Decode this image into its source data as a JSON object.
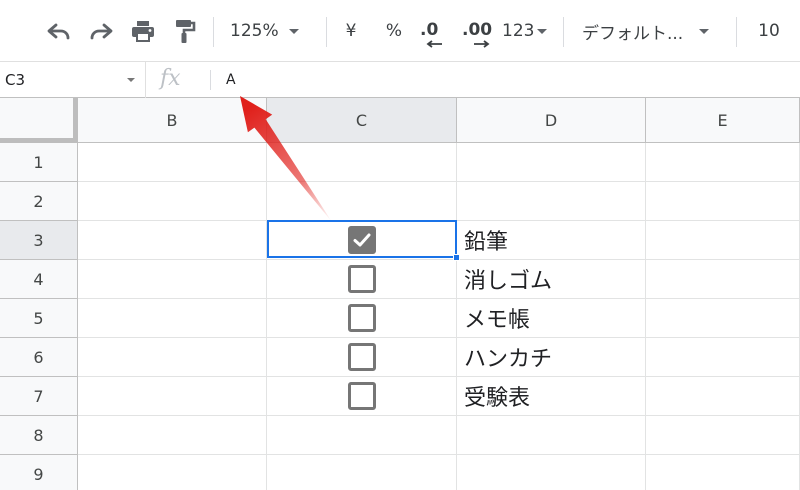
{
  "toolbar": {
    "zoom": "125%",
    "currency_symbol": "¥",
    "percent_symbol": "%",
    "decrease_decimal_label": ".0",
    "increase_decimal_label": ".00",
    "more_formats_label": "123",
    "font_name": "デフォルト...",
    "font_size": "10",
    "icons": [
      "undo-icon",
      "redo-icon",
      "print-icon",
      "paint-format-icon"
    ]
  },
  "formula_bar": {
    "name_box": "C3",
    "fx_label": "fx",
    "value": "A"
  },
  "columns": [
    "B",
    "C",
    "D",
    "E"
  ],
  "active_column": "C",
  "rows": [
    {
      "num": "1",
      "checkbox": null,
      "item": ""
    },
    {
      "num": "2",
      "checkbox": null,
      "item": ""
    },
    {
      "num": "3",
      "checkbox": true,
      "item": "鉛筆"
    },
    {
      "num": "4",
      "checkbox": false,
      "item": "消しゴム"
    },
    {
      "num": "5",
      "checkbox": false,
      "item": "メモ帳"
    },
    {
      "num": "6",
      "checkbox": false,
      "item": "ハンカチ"
    },
    {
      "num": "7",
      "checkbox": false,
      "item": "受験表"
    },
    {
      "num": "8",
      "checkbox": null,
      "item": ""
    },
    {
      "num": "9",
      "checkbox": null,
      "item": ""
    }
  ],
  "active_row": "3",
  "colors": {
    "selection": "#1a73e8",
    "annotation_arrow": "#e0201b",
    "checkbox": "#767676"
  }
}
